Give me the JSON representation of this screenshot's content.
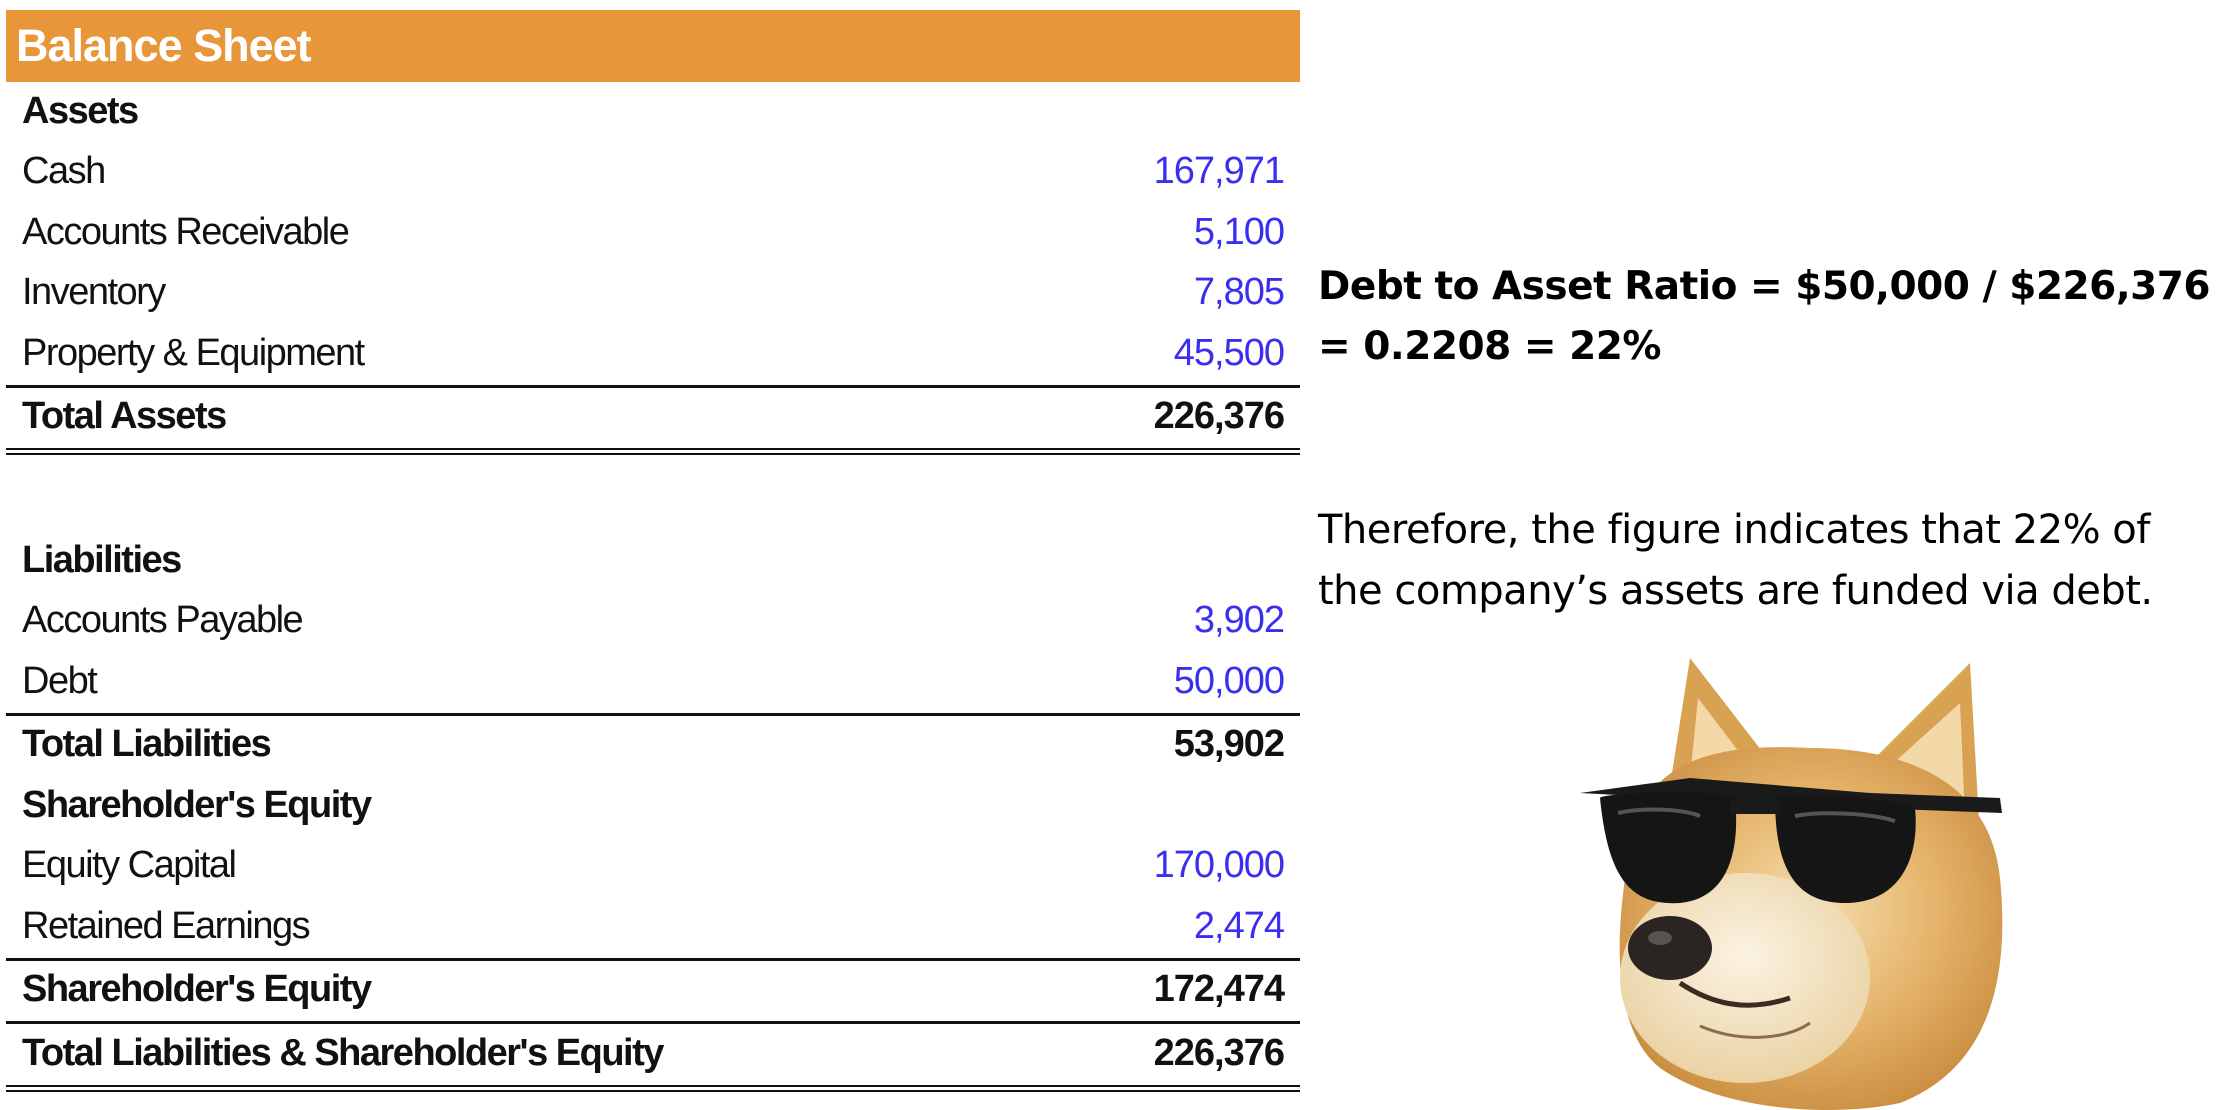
{
  "balance_sheet": {
    "title": "Balance Sheet",
    "assets": {
      "heading": "Assets",
      "items": [
        {
          "label": "Cash",
          "value": "167,971"
        },
        {
          "label": "Accounts Receivable",
          "value": "5,100"
        },
        {
          "label": "Inventory",
          "value": "7,805"
        },
        {
          "label": "Property & Equipment",
          "value": "45,500"
        }
      ],
      "total_label": "Total Assets",
      "total_value": "226,376"
    },
    "liabilities": {
      "heading": "Liabilities",
      "items": [
        {
          "label": "Accounts Payable",
          "value": "3,902"
        },
        {
          "label": "Debt",
          "value": "50,000"
        }
      ],
      "total_label": "Total Liabilities",
      "total_value": "53,902"
    },
    "equity": {
      "heading": "Shareholder's Equity",
      "items": [
        {
          "label": "Equity Capital",
          "value": "170,000"
        },
        {
          "label": "Retained Earnings",
          "value": "2,474"
        }
      ],
      "total_label": "Shareholder's Equity",
      "total_value": "172,474"
    },
    "grand_total_label": "Total Liabilities & Shareholder's Equity",
    "grand_total_value": "226,376"
  },
  "commentary": {
    "formula": "Debt to Asset Ratio = $50,000 / $226,376 = 0.2208 = 22%",
    "conclusion": "Therefore, the figure indicates that 22% of the company’s assets are funded via debt."
  },
  "colors": {
    "header_bg": "#E8963A",
    "input_value": "#3a2ff0"
  }
}
